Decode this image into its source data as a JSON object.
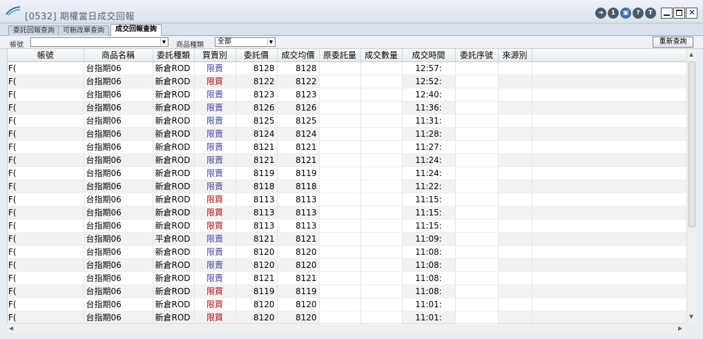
{
  "window": {
    "title": "[0532] 期權當日成交回報"
  },
  "tabs": [
    {
      "label": "委託回報查詢"
    },
    {
      "label": "可刪改單查詢"
    },
    {
      "label": "成交回報查詢"
    }
  ],
  "filters": {
    "account_label": "帳號",
    "account_value": "",
    "product_type_label": "商品種類",
    "product_type_value": "全部",
    "requery_button": "重新查詢"
  },
  "titlebar_buttons": [
    "export-icon",
    "number-one-icon",
    "print-icon",
    "help-icon",
    "t-icon"
  ],
  "colors": {
    "sell": "#3c3ca8",
    "buy": "#c00000"
  },
  "table": {
    "columns": [
      "帳號",
      "商品名稱",
      "委託種類",
      "買賣別",
      "委託價",
      "成交均價",
      "原委託量",
      "成交數量",
      "成交時間",
      "委託序號",
      "來源別"
    ],
    "rows": [
      [
        "F(",
        "台指期06",
        "新倉ROD",
        "限賣",
        "8128",
        "8128",
        "",
        "",
        "12:57:",
        "",
        ""
      ],
      [
        "F(",
        "台指期06",
        "新倉ROD",
        "限買",
        "8122",
        "8122",
        "",
        "",
        "12:52:",
        "",
        ""
      ],
      [
        "F(",
        "台指期06",
        "新倉ROD",
        "限賣",
        "8123",
        "8123",
        "",
        "",
        "12:40:",
        "",
        ""
      ],
      [
        "F(",
        "台指期06",
        "新倉ROD",
        "限賣",
        "8126",
        "8126",
        "",
        "",
        "11:36:",
        "",
        ""
      ],
      [
        "F(",
        "台指期06",
        "新倉ROD",
        "限賣",
        "8125",
        "8125",
        "",
        "",
        "11:31:",
        "",
        ""
      ],
      [
        "F(",
        "台指期06",
        "新倉ROD",
        "限賣",
        "8124",
        "8124",
        "",
        "",
        "11:28:",
        "",
        ""
      ],
      [
        "F(",
        "台指期06",
        "新倉ROD",
        "限賣",
        "8121",
        "8121",
        "",
        "",
        "11:27:",
        "",
        ""
      ],
      [
        "F(",
        "台指期06",
        "新倉ROD",
        "限賣",
        "8121",
        "8121",
        "",
        "",
        "11:24:",
        "",
        ""
      ],
      [
        "F(",
        "台指期06",
        "新倉ROD",
        "限賣",
        "8119",
        "8119",
        "",
        "",
        "11:24:",
        "",
        ""
      ],
      [
        "F(",
        "台指期06",
        "新倉ROD",
        "限賣",
        "8118",
        "8118",
        "",
        "",
        "11:22:",
        "",
        ""
      ],
      [
        "F(",
        "台指期06",
        "新倉ROD",
        "限買",
        "8113",
        "8113",
        "",
        "",
        "11:15:",
        "",
        ""
      ],
      [
        "F(",
        "台指期06",
        "新倉ROD",
        "限買",
        "8113",
        "8113",
        "",
        "",
        "11:15:",
        "",
        ""
      ],
      [
        "F(",
        "台指期06",
        "新倉ROD",
        "限買",
        "8113",
        "8113",
        "",
        "",
        "11:15:",
        "",
        ""
      ],
      [
        "F(",
        "台指期06",
        "平倉ROD",
        "限賣",
        "8121",
        "8121",
        "",
        "",
        "11:09:",
        "",
        ""
      ],
      [
        "F(",
        "台指期06",
        "新倉ROD",
        "限賣",
        "8120",
        "8120",
        "",
        "",
        "11:08:",
        "",
        ""
      ],
      [
        "F(",
        "台指期06",
        "新倉ROD",
        "限賣",
        "8120",
        "8120",
        "",
        "",
        "11:08:",
        "",
        ""
      ],
      [
        "F(",
        "台指期06",
        "新倉ROD",
        "限賣",
        "8121",
        "8121",
        "",
        "",
        "11:08:",
        "",
        ""
      ],
      [
        "F(",
        "台指期06",
        "新倉ROD",
        "限買",
        "8119",
        "8119",
        "",
        "",
        "11:08:",
        "",
        ""
      ],
      [
        "F(",
        "台指期06",
        "新倉ROD",
        "限買",
        "8120",
        "8120",
        "",
        "",
        "11:01:",
        "",
        ""
      ],
      [
        "F(",
        "台指期06",
        "新倉ROD",
        "限買",
        "8120",
        "8120",
        "",
        "",
        "11:01:",
        "",
        ""
      ]
    ]
  }
}
